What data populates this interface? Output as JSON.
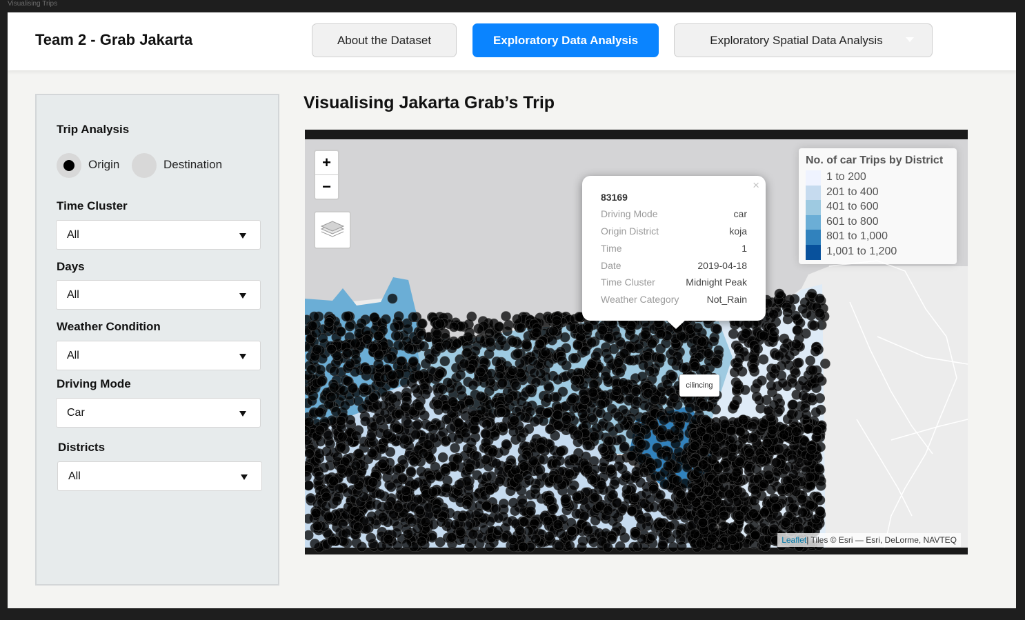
{
  "window": {
    "title": "Visualising Trips"
  },
  "header": {
    "brand": "Team 2 - Grab Jakarta",
    "tabs": [
      {
        "label": "About the Dataset",
        "active": false
      },
      {
        "label": "Exploratory Data Analysis",
        "active": true
      },
      {
        "label": "Exploratory Spatial Data Analysis",
        "active": false,
        "has_dropdown": true
      }
    ]
  },
  "sidebar": {
    "trip_analysis": {
      "label": "Trip Analysis",
      "options": [
        {
          "label": "Origin",
          "selected": true
        },
        {
          "label": "Destination",
          "selected": false
        }
      ]
    },
    "time_cluster": {
      "label": "Time Cluster",
      "value": "All"
    },
    "days": {
      "label": "Days",
      "value": "All"
    },
    "weather_condition": {
      "label": "Weather Condition",
      "value": "All"
    },
    "driving_mode": {
      "label": "Driving Mode",
      "value": "Car"
    },
    "districts": {
      "label": "Districts",
      "value": "All"
    }
  },
  "main": {
    "title": "Visualising Jakarta Grab’s Trip",
    "map": {
      "zoom_in": "+",
      "zoom_out": "−",
      "layers_icon": "layers-icon",
      "popup": {
        "id": "83169",
        "close": "×",
        "rows": [
          {
            "key": "Driving Mode",
            "value": "car"
          },
          {
            "key": "Origin District",
            "value": "koja"
          },
          {
            "key": "Time",
            "value": "1"
          },
          {
            "key": "Date",
            "value": "2019-04-18"
          },
          {
            "key": "Time Cluster",
            "value": "Midnight Peak"
          },
          {
            "key": "Weather Category",
            "value": "Not_Rain"
          }
        ]
      },
      "tooltip": "cilincing",
      "legend": {
        "title": "No. of car Trips by District",
        "items": [
          {
            "label": "1 to 200",
            "color": "#eff3ff"
          },
          {
            "label": "201 to 400",
            "color": "#c6dbef"
          },
          {
            "label": "401 to 600",
            "color": "#9ecae1"
          },
          {
            "label": "601 to 800",
            "color": "#6baed6"
          },
          {
            "label": "801 to 1,000",
            "color": "#3182bd"
          },
          {
            "label": "1,001 to 1,200",
            "color": "#08519c"
          }
        ]
      },
      "attribution": {
        "leaflet": "Leaflet",
        "text": " | Tiles © Esri — Esri, DeLorme, NAVTEQ"
      }
    }
  },
  "colors": {
    "accent": "#0a84ff",
    "sea": "#d4d4d6",
    "land": "#ececec",
    "points": "#000000"
  }
}
